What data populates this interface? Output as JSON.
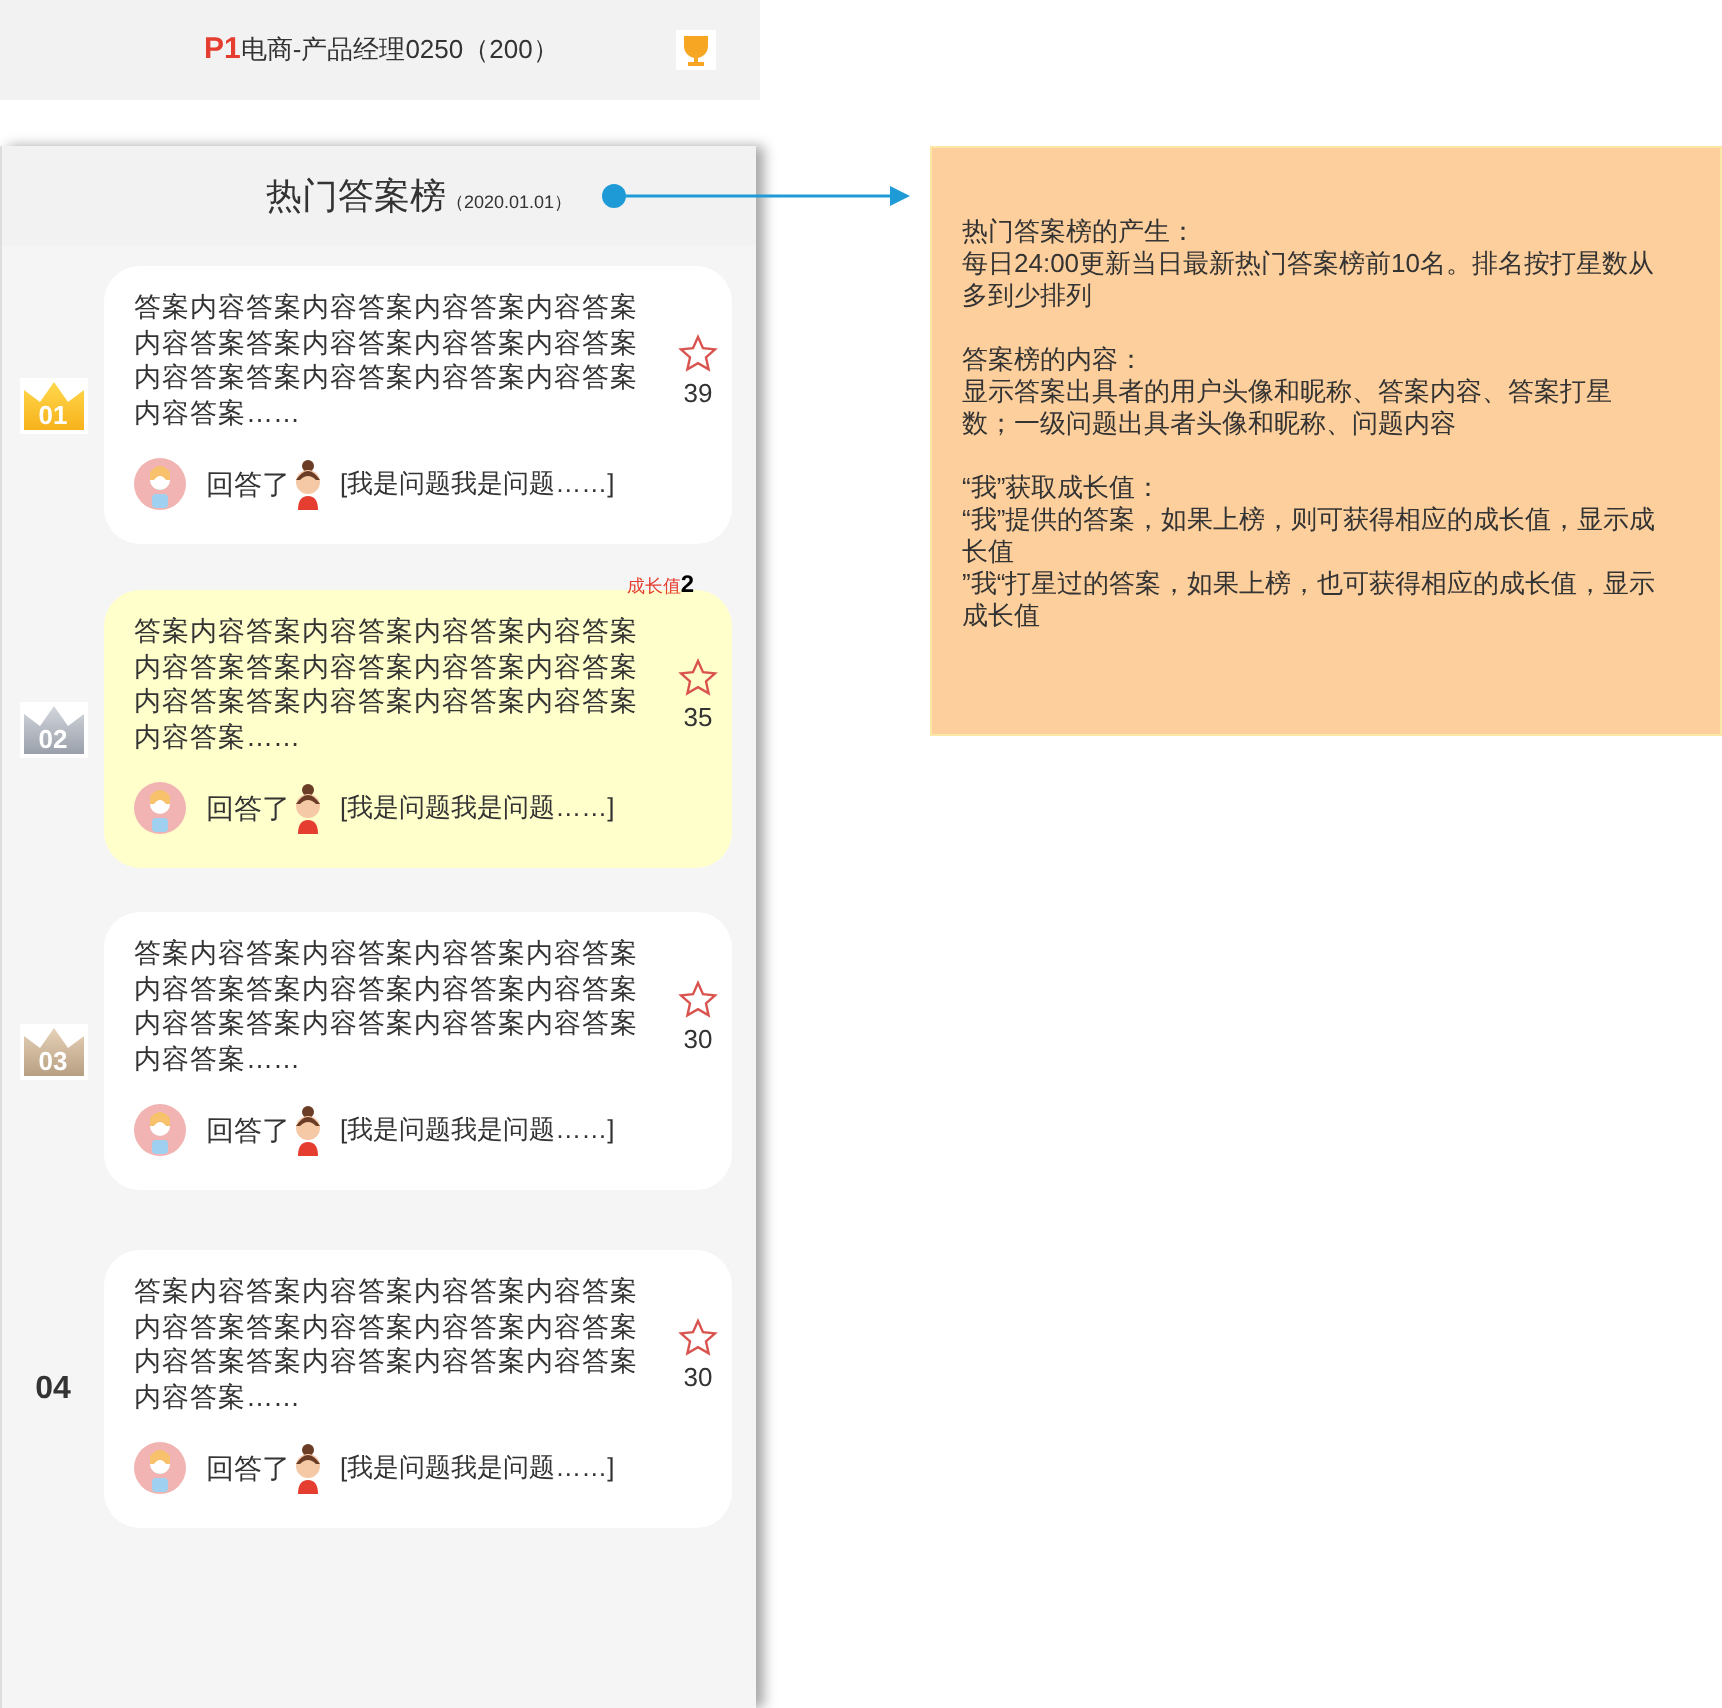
{
  "top_bar": {
    "level_badge": "P1",
    "user": "电商-产品经理0250（200）"
  },
  "panel": {
    "title": "热门答案榜",
    "date": "（2020.01.01）"
  },
  "entries": [
    {
      "rank": "01",
      "kind": "gold",
      "highlighted": false,
      "answer": "答案内容答案内容答案内容答案内容答案内容答案答案内容答案内容答案内容答案内容答案答案内容答案内容答案内容答案内容答案……",
      "stars_count": "39",
      "answered": "回答了",
      "question": "[我是问题我是问题……]"
    },
    {
      "rank": "02",
      "kind": "silver",
      "highlighted": true,
      "growth_label": "成长值",
      "growth_value": "2",
      "answer": "答案内容答案内容答案内容答案内容答案内容答案答案内容答案内容答案内容答案内容答案答案内容答案内容答案内容答案内容答案……",
      "stars_count": "35",
      "answered": "回答了",
      "question": "[我是问题我是问题……]"
    },
    {
      "rank": "03",
      "kind": "bronze",
      "highlighted": false,
      "answer": "答案内容答案内容答案内容答案内容答案内容答案答案内容答案内容答案内容答案内容答案答案内容答案内容答案内容答案内容答案……",
      "stars_count": "30",
      "answered": "回答了",
      "question": "[我是问题我是问题……]"
    },
    {
      "rank": "04",
      "kind": "plain",
      "highlighted": false,
      "answer": "答案内容答案内容答案内容答案内容答案内容答案答案内容答案内容答案内容答案内容答案答案内容答案内容答案内容答案内容答案……",
      "stars_count": "30",
      "answered": "回答了",
      "question": "[我是问题我是问题……]"
    }
  ],
  "note": [
    {
      "heading": "热门答案榜的产生：",
      "lines": [
        "每日24:00更新当日最新热门答案榜前10名。排名按打星数从多到少排列"
      ]
    },
    {
      "heading": "答案榜的内容：",
      "lines": [
        "显示答案出具者的用户头像和昵称、答案内容、答案打星数；一级问题出具者头像和昵称、问题内容"
      ]
    },
    {
      "heading": "“我”获取成长值：",
      "lines": [
        "“我”提供的答案，如果上榜，则可获得相应的成长值，显示成长值",
        "”我“打星过的答案，如果上榜，也可获得相应的成长值，显示成长值"
      ]
    }
  ]
}
